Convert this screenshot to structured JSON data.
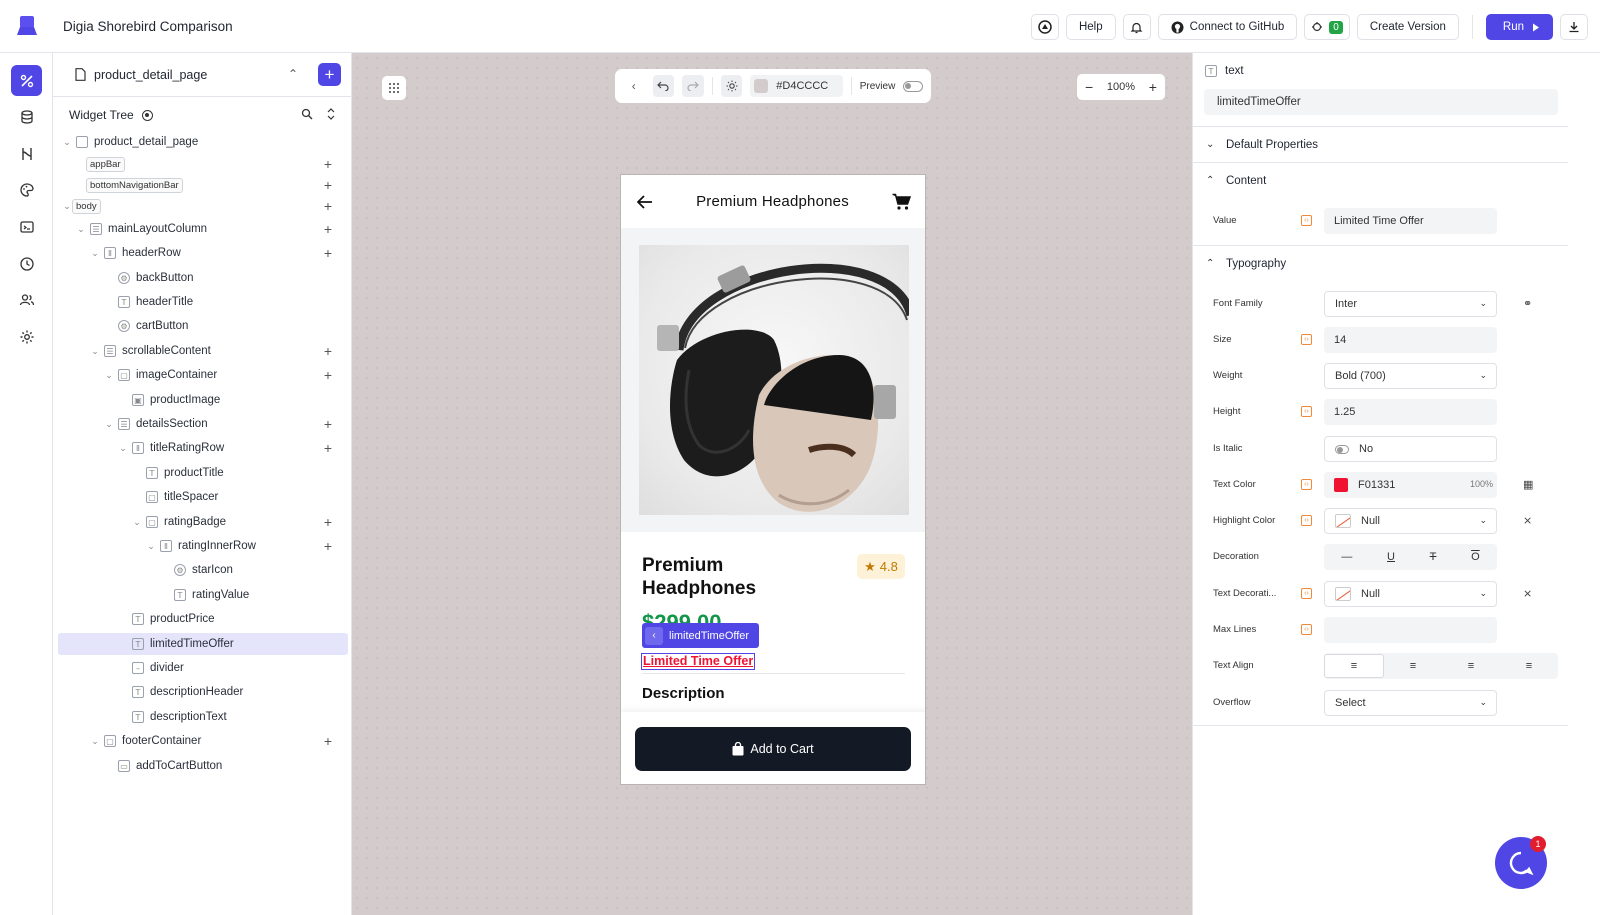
{
  "app": {
    "title": "Digia Shorebird Comparison"
  },
  "topbar": {
    "help": "Help",
    "connect_github": "Connect to GitHub",
    "build_count": "0",
    "create_version": "Create Version",
    "run": "Run"
  },
  "rail": {
    "items": [
      "design-icon",
      "database-icon",
      "api-icon",
      "theme-icon",
      "console-icon",
      "history-icon",
      "users-icon",
      "settings-icon"
    ],
    "active": "design-icon"
  },
  "tree_panel": {
    "page_name": "product_detail_page",
    "widget_tree_label": "Widget Tree",
    "nodes": [
      {
        "label": "product_detail_page"
      },
      {
        "label": "appBar"
      },
      {
        "label": "bottomNavigationBar"
      },
      {
        "label": "body"
      },
      {
        "label": "mainLayoutColumn"
      },
      {
        "label": "headerRow"
      },
      {
        "label": "backButton"
      },
      {
        "label": "headerTitle"
      },
      {
        "label": "cartButton"
      },
      {
        "label": "scrollableContent"
      },
      {
        "label": "imageContainer"
      },
      {
        "label": "productImage"
      },
      {
        "label": "detailsSection"
      },
      {
        "label": "titleRatingRow"
      },
      {
        "label": "productTitle"
      },
      {
        "label": "titleSpacer"
      },
      {
        "label": "ratingBadge"
      },
      {
        "label": "ratingInnerRow"
      },
      {
        "label": "starIcon"
      },
      {
        "label": "ratingValue"
      },
      {
        "label": "productPrice"
      },
      {
        "label": "limitedTimeOffer"
      },
      {
        "label": "divider"
      },
      {
        "label": "descriptionHeader"
      },
      {
        "label": "descriptionText"
      },
      {
        "label": "footerContainer"
      },
      {
        "label": "addToCartButton"
      }
    ],
    "selected": "limitedTimeOffer"
  },
  "canvas": {
    "background_color": "#D4CCCC",
    "preview_label": "Preview",
    "zoom": "100%"
  },
  "phone": {
    "header_title": "Premium Headphones",
    "product_title": "Premium Headphones",
    "rating": "4.8",
    "price": "$299.00",
    "selected_tag": "limitedTimeOffer",
    "limited_offer": "Limited Time Offer",
    "description_header": "Description",
    "add_to_cart": "Add to Cart"
  },
  "props": {
    "widget_type": "text",
    "widget_name": "limitedTimeOffer",
    "sections": {
      "default_properties": "Default Properties",
      "content": "Content",
      "typography": "Typography"
    },
    "content": {
      "value_label": "Value",
      "value": "Limited Time Offer"
    },
    "typography": {
      "font_family_label": "Font Family",
      "font_family": "Inter",
      "size_label": "Size",
      "size": "14",
      "weight_label": "Weight",
      "weight": "Bold (700)",
      "height_label": "Height",
      "height": "1.25",
      "italic_label": "Is Italic",
      "italic": "No",
      "text_color_label": "Text Color",
      "text_color": "F01331",
      "text_color_opacity": "100%",
      "highlight_label": "Highlight Color",
      "highlight": "Null",
      "decoration_label": "Decoration",
      "text_decoration_label": "Text Decorati...",
      "text_decoration": "Null",
      "max_lines_label": "Max Lines",
      "max_lines": "",
      "text_align_label": "Text Align",
      "overflow_label": "Overflow",
      "overflow": "Select"
    }
  },
  "chat": {
    "unread": "1"
  },
  "colors": {
    "accent": "#4f46e5",
    "text_red": "#F01331",
    "price_green": "#13954a"
  }
}
